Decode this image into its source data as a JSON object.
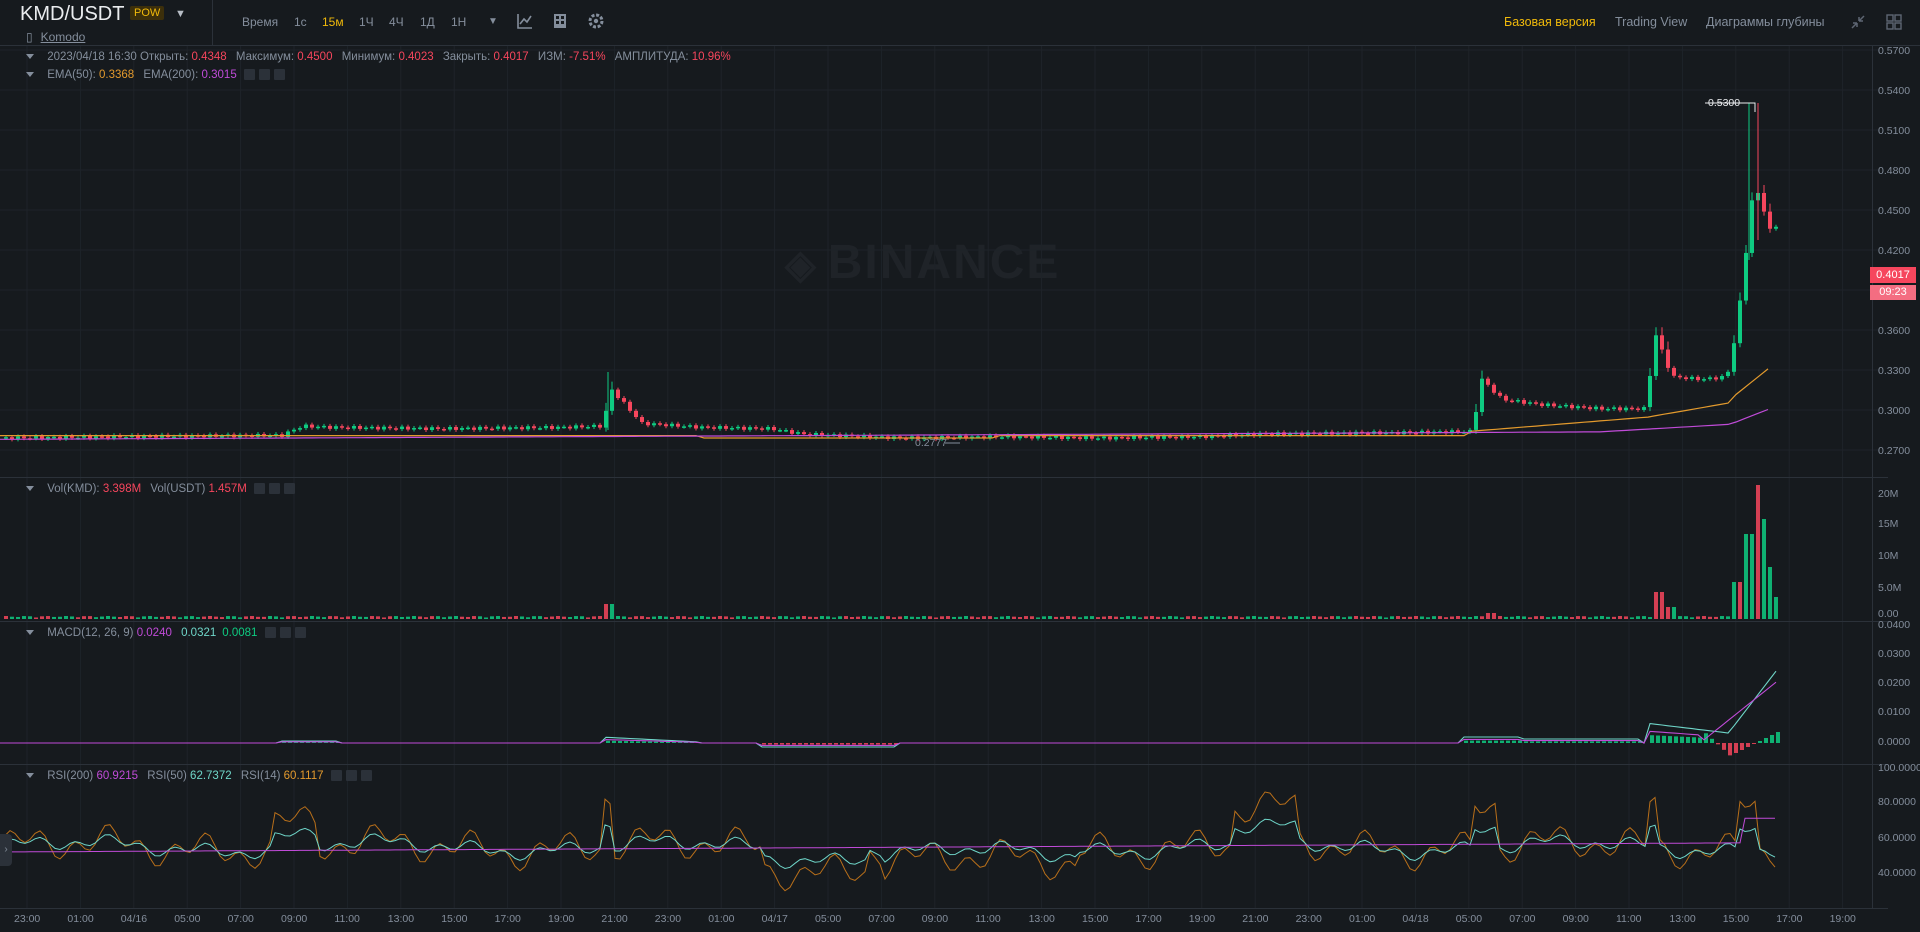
{
  "header": {
    "symbol": "KMD/USDT",
    "tag": "POW",
    "name": "Komodo",
    "timeframes": [
      "Время",
      "1с",
      "15м",
      "1Ч",
      "4Ч",
      "1Д",
      "1Н"
    ],
    "active_timeframe": "15м",
    "nav": [
      "Базовая версия",
      "Trading View",
      "Диаграммы глубины"
    ],
    "active_nav": "Базовая версия"
  },
  "ohlc": {
    "date": "2023/04/18 16:30",
    "open_label": "Открыть:",
    "open": "0.4348",
    "high_label": "Максимум:",
    "high": "0.4500",
    "low_label": "Минимум:",
    "low": "0.4023",
    "close_label": "Закрыть:",
    "close": "0.4017",
    "change_label": "ИЗМ:",
    "change": "-7.51%",
    "amp_label": "АМПЛИТУДА:",
    "amp": "10.96%"
  },
  "ema": {
    "ema50_label": "EMA(50):",
    "ema50": "0.3368",
    "ema200_label": "EMA(200):",
    "ema200": "0.3015"
  },
  "vol": {
    "kmd_label": "Vol(KMD):",
    "kmd": "3.398M",
    "usdt_label": "Vol(USDT)",
    "usdt": "1.457M"
  },
  "macd": {
    "label": "MACD(12, 26, 9)",
    "v1": "0.0240",
    "v2": "0.0321",
    "v3": "0.0081"
  },
  "rsi": {
    "rsi200_label": "RSI(200)",
    "rsi200": "60.9215",
    "rsi50_label": "RSI(50)",
    "rsi50": "62.7372",
    "rsi14_label": "RSI(14)",
    "rsi14": "60.1117"
  },
  "watermark": "BINANCE",
  "last_price": "0.4017",
  "countdown": "09:23",
  "high_marker": "0.5300",
  "low_marker": "0.2777",
  "price_axis": [
    "0.5700",
    "0.5400",
    "0.5100",
    "0.4800",
    "0.4500",
    "0.4200",
    "0.3600",
    "0.3300",
    "0.3000",
    "0.2700"
  ],
  "volume_axis": [
    "20M",
    "15M",
    "10M",
    "5.0M",
    "0.00"
  ],
  "macd_axis": [
    "0.0400",
    "0.0300",
    "0.0200",
    "0.0100",
    "0.0000"
  ],
  "rsi_axis": [
    "100.0000",
    "80.0000",
    "60.0000",
    "40.0000"
  ],
  "time_axis": [
    "23:00",
    "01:00",
    "04/16",
    "05:00",
    "07:00",
    "09:00",
    "11:00",
    "13:00",
    "15:00",
    "17:00",
    "19:00",
    "21:00",
    "23:00",
    "01:00",
    "04/17",
    "05:00",
    "07:00",
    "09:00",
    "11:00",
    "13:00",
    "15:00",
    "17:00",
    "19:00",
    "21:00",
    "23:00",
    "01:00",
    "04/18",
    "05:00",
    "07:00",
    "09:00",
    "11:00",
    "13:00",
    "15:00",
    "17:00",
    "19:00"
  ],
  "colors": {
    "up": "#0ecb81",
    "down": "#f6465d",
    "ema50": "#e39a2d",
    "ema200": "#c04bd8",
    "accent": "#f0b90b"
  },
  "chart_data": {
    "type": "candlestick",
    "ylim": [
      0.26,
      0.57
    ],
    "candles_sampled": [
      {
        "t": "04/15 22:00",
        "close": 0.28
      },
      {
        "t": "04/16 06:00",
        "close": 0.282
      },
      {
        "t": "04/16 09:00",
        "close": 0.287
      },
      {
        "t": "04/16 20:45",
        "close": 0.309
      },
      {
        "t": "04/17 04:00",
        "close": 0.284
      },
      {
        "t": "04/17 09:00",
        "close": 0.279
      },
      {
        "t": "04/18 05:00",
        "close": 0.282
      },
      {
        "t": "04/18 05:45",
        "close": 0.322
      },
      {
        "t": "04/18 11:45",
        "close": 0.359
      },
      {
        "t": "04/18 13:00",
        "close": 0.324
      },
      {
        "t": "04/18 15:00",
        "close": 0.47
      },
      {
        "t": "04/18 16:30",
        "close": 0.4017
      }
    ]
  }
}
